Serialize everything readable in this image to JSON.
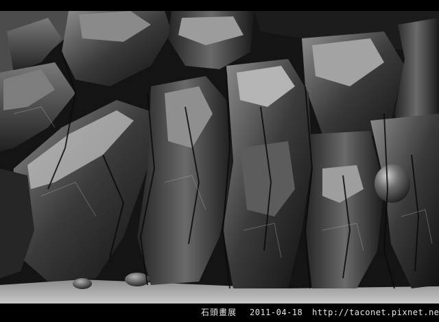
{
  "caption": {
    "title": "石頭畫展",
    "date": "2011-04-18",
    "url": "http://taconet.pixnet.net"
  },
  "colors": {
    "frame": "#000000",
    "rock_dark": "#121212",
    "rock_mid": "#4a4a4a",
    "rock_light": "#9a9a9a",
    "sand": "#bdbdbd"
  }
}
